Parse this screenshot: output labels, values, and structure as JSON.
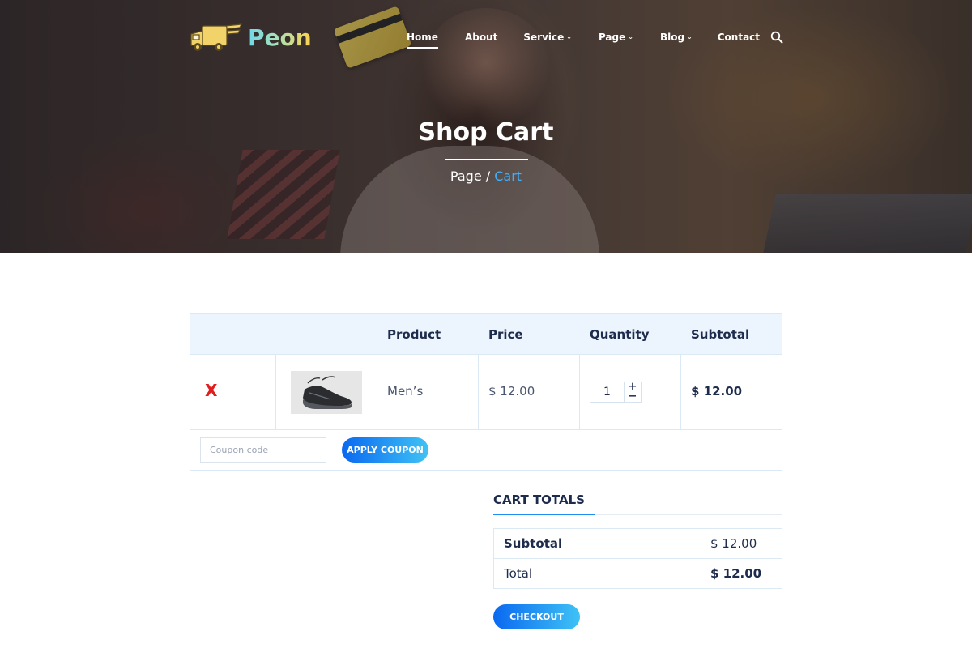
{
  "brand": {
    "name": "Peon"
  },
  "nav": {
    "items": [
      {
        "label": "Home",
        "active": true,
        "dropdown": false
      },
      {
        "label": "About",
        "active": false,
        "dropdown": false
      },
      {
        "label": "Service",
        "active": false,
        "dropdown": true
      },
      {
        "label": "Page",
        "active": false,
        "dropdown": true
      },
      {
        "label": "Blog",
        "active": false,
        "dropdown": true
      },
      {
        "label": "Contact",
        "active": false,
        "dropdown": false
      }
    ],
    "search_icon": "search-icon"
  },
  "hero": {
    "title": "Shop Cart",
    "breadcrumb": {
      "parent": "Page",
      "separator": "/",
      "current": "Cart"
    }
  },
  "cart": {
    "columns": [
      "Product",
      "Price",
      "Quantity",
      "Subtotal"
    ],
    "rows": [
      {
        "remove": "X",
        "image": "sneaker-image",
        "product": "Men’s",
        "price": "$ 12.00",
        "quantity": "1",
        "subtotal": "$ 12.00"
      }
    ],
    "qty_plus": "+",
    "qty_minus": "−",
    "coupon_placeholder": "Coupon code",
    "apply_label": "APPLY COUPON"
  },
  "totals": {
    "title": "CART TOTALS",
    "subtotal_label": "Subtotal",
    "subtotal_value": "$ 12.00",
    "total_label": "Total",
    "total_value": "$ 12.00",
    "checkout_label": "CHECKOUT"
  },
  "colors": {
    "accent_blue": "#0a69f0",
    "accent_cyan": "#3fc2f5",
    "breadcrumb_current": "#3fb0ff",
    "remove_red": "#e11d1d",
    "header_bg": "#ecf4fd"
  }
}
